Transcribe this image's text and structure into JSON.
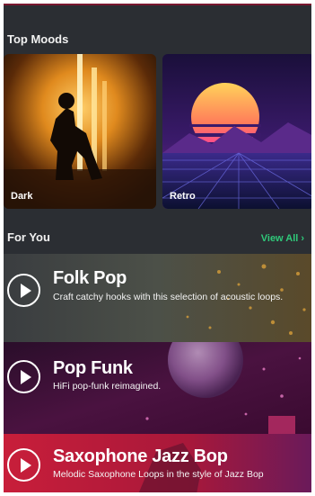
{
  "top_moods": {
    "title": "Top Moods",
    "cards": [
      {
        "label": "Dark"
      },
      {
        "label": "Retro"
      }
    ]
  },
  "for_you": {
    "title": "For You",
    "view_all": "View All",
    "playlists": [
      {
        "title": "Folk Pop",
        "description": "Craft catchy hooks with this selection of acoustic loops."
      },
      {
        "title": "Pop Funk",
        "description": "HiFi pop-funk reimagined."
      },
      {
        "title": "Saxophone Jazz Bop",
        "description": "Melodic Saxophone Loops in the style of Jazz Bop"
      }
    ]
  },
  "colors": {
    "background": "#2b2e33",
    "accent": "#2fc97a"
  }
}
